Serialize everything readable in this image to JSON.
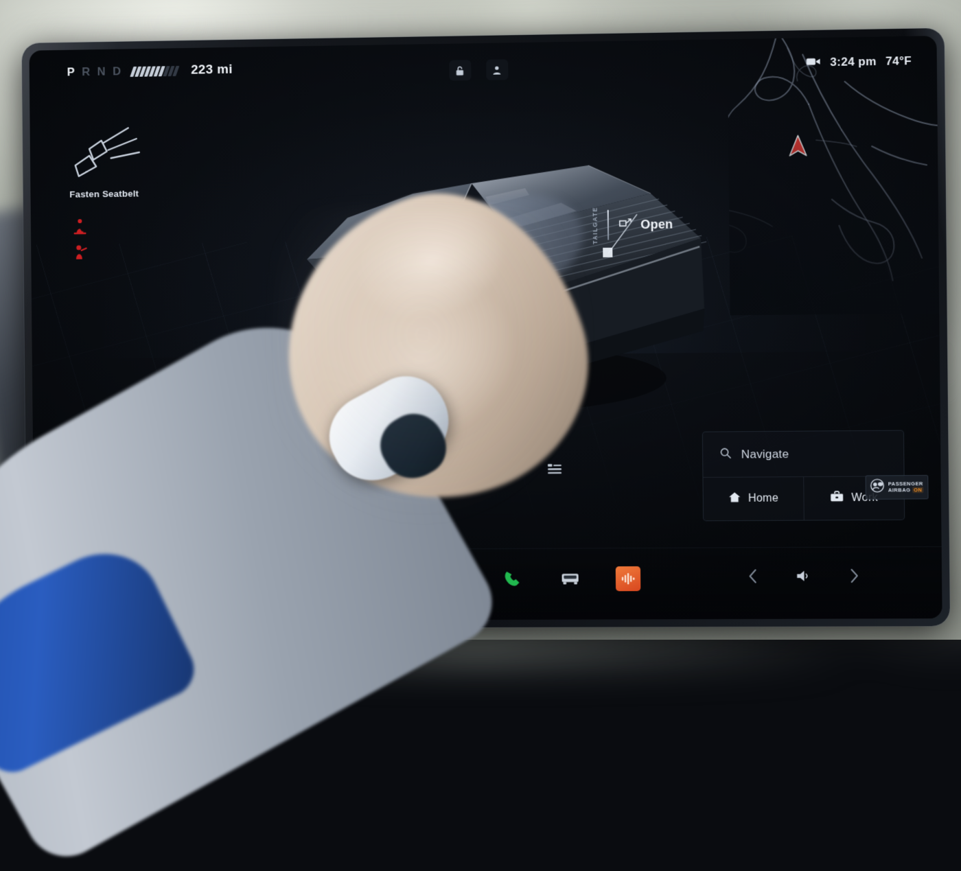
{
  "status_bar": {
    "gear_letters": [
      {
        "letter": "P",
        "active": true
      },
      {
        "letter": "R",
        "active": false
      },
      {
        "letter": "N",
        "active": false
      },
      {
        "letter": "D",
        "active": false
      }
    ],
    "battery_segments_total": 10,
    "battery_segments_filled": 7,
    "range": "223 mi",
    "lock_icon": "lock-icon",
    "profile_icon": "profile-icon",
    "dashcam_icon": "dashcam-icon",
    "time": "3:24 pm",
    "temperature": "74°F"
  },
  "alerts": {
    "seatbelt_icon": "seatbelt-icon",
    "seatbelt_label": "Fasten Seatbelt",
    "warning_icons": [
      {
        "name": "driver-seatbelt-warning-icon",
        "color": "#cc1f22"
      },
      {
        "name": "passenger-seatbelt-warning-icon",
        "color": "#cc1f22"
      }
    ]
  },
  "vehicle": {
    "model_name": "cybertruck-3d-render",
    "tailgate_callout": {
      "vertical_label": "TAILGATE",
      "action_icon": "tailgate-icon",
      "action_label": "Open"
    }
  },
  "map": {
    "nav_cursor_icon": "navigation-arrow-icon",
    "nav_cursor_color": "#e03a34"
  },
  "nav_card": {
    "search_icon": "search-icon",
    "search_placeholder": "Navigate",
    "shortcuts": [
      {
        "icon": "home-icon",
        "label": "Home"
      },
      {
        "icon": "briefcase-icon",
        "label": "Work"
      }
    ]
  },
  "list_toggle": {
    "icon": "list-view-icon"
  },
  "airbag_badge": {
    "icon": "airbag-icon",
    "line1": "PASSENGER",
    "line2": "AIRBAG",
    "state": "ON",
    "state_color": "#e98a22"
  },
  "taskbar": {
    "left": {
      "icon": "vehicle-controls-icon"
    },
    "apps": [
      {
        "name": "bluetooth-icon",
        "color": "#1b6ed8"
      },
      {
        "name": "messages-icon",
        "color": "#2f7cd4"
      },
      {
        "name": "more-apps-icon",
        "color": "#2a2f38"
      },
      {
        "name": "phone-icon",
        "color": "#21b84f"
      },
      {
        "name": "vehicle-icon",
        "color": "#c9d1db"
      },
      {
        "name": "media-audio-icon",
        "color": "#e3622a"
      }
    ],
    "right": [
      {
        "name": "previous-track-icon"
      },
      {
        "name": "volume-icon"
      },
      {
        "name": "next-track-icon"
      }
    ]
  }
}
